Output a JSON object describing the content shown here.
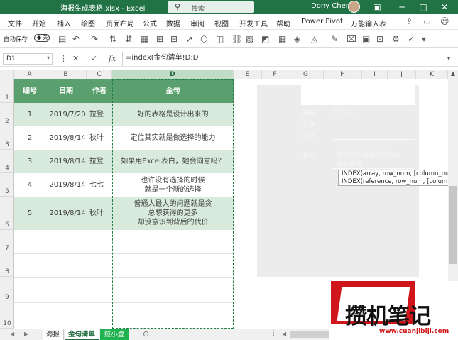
{
  "title_bar": {
    "filename": "海报生成表格.xlsx - Excel",
    "search_placeholder": "搜索",
    "user": "Dony Chen",
    "minimize": "─",
    "restore": "□",
    "close": "✕"
  },
  "menu": [
    "文件",
    "开始",
    "插入",
    "绘图",
    "页面布局",
    "公式",
    "数据",
    "审阅",
    "视图",
    "开发工具",
    "帮助",
    "Power Pivot",
    "万能输入表"
  ],
  "qat": {
    "autosave_label": "自动保存",
    "autosave_state": "关"
  },
  "formula_bar": {
    "name_box": "D1",
    "formula": "=index(金句清单!D:D"
  },
  "columns": [
    "A",
    "B",
    "C",
    "D",
    "E",
    "F",
    "G",
    "H",
    "I",
    "J",
    "K"
  ],
  "rows": [
    "1",
    "2",
    "3",
    "4",
    "5",
    "6",
    "7",
    "8",
    "9",
    "10"
  ],
  "table": {
    "headers": {
      "id": "编号",
      "date": "日期",
      "author": "作者",
      "quote": "金句"
    },
    "records": [
      {
        "id": "1",
        "date": "2019/7/20",
        "author": "拉登",
        "quote": [
          "好的表格是设计出来的"
        ]
      },
      {
        "id": "2",
        "date": "2019/8/14",
        "author": "秋叶",
        "quote": [
          "定位其实就是做选择的能力"
        ]
      },
      {
        "id": "3",
        "date": "2019/8/14",
        "author": "拉登",
        "quote": [
          "如果用Excel表白，她会同意吗？"
        ]
      },
      {
        "id": "4",
        "date": "2019/8/14",
        "author": "七七",
        "quote": [
          "也许没有选择的时候",
          "就是一个新的选择"
        ]
      },
      {
        "id": "5",
        "date": "2019/8/14",
        "author": "秋叶",
        "quote": [
          "普通人最大的问题就是贪",
          "总想获得的更多",
          "却没意识到背后的代价"
        ]
      }
    ]
  },
  "preview_panel": {
    "labels": [
      "编号",
      "日期",
      "作者",
      "金句"
    ],
    "number_value": "NO.01",
    "quote_value": [
      "好的表格是设计出来的",
      "好的表格"
    ]
  },
  "tooltip": {
    "line1": "INDEX(array, row_num, [column_num])",
    "line2": "INDEX(reference, row_num, [column_nu"
  },
  "sheet_tabs": [
    "海报",
    "金句清单",
    "拉小登"
  ],
  "watermark": {
    "brand": "攒机笔记",
    "url": "www.cuanjibiji.com"
  },
  "colors": {
    "excel_green": "#217346",
    "header_green": "#5aa06e",
    "band_green": "#d7eadc",
    "watermark_red": "#d0161a"
  }
}
